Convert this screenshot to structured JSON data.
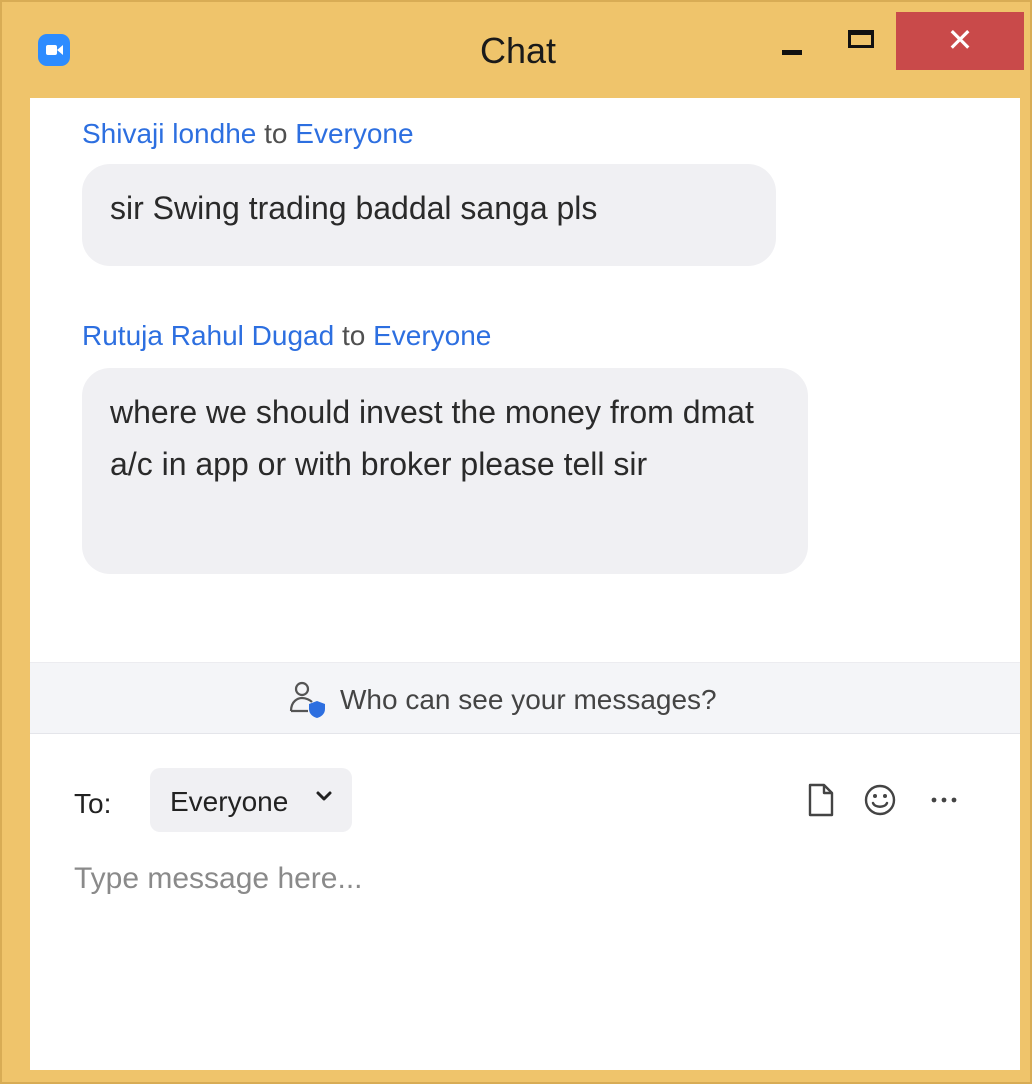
{
  "window": {
    "title": "Chat",
    "close_glyph": "✕",
    "colors": {
      "frame": "#efc46b",
      "close": "#c94a4a",
      "link": "#2d6fe0",
      "bubble": "#f0f0f3"
    }
  },
  "messages": [
    {
      "sender": "Shivaji londhe",
      "to_word": "to",
      "recipient": "Everyone",
      "text": "sir Swing trading baddal sanga pls"
    },
    {
      "sender": "Rutuja Rahul Dugad",
      "to_word": "to",
      "recipient": "Everyone",
      "text": "where we should invest the money from dmat a/c in app or with broker please tell sir"
    }
  ],
  "privacy_notice": {
    "icon": "person-shield-icon",
    "text": "Who can see your messages?"
  },
  "composer": {
    "to_label": "To:",
    "recipient": "Everyone",
    "placeholder": "Type message here...",
    "icons": [
      "file-icon",
      "emoji-icon",
      "more-icon"
    ]
  }
}
